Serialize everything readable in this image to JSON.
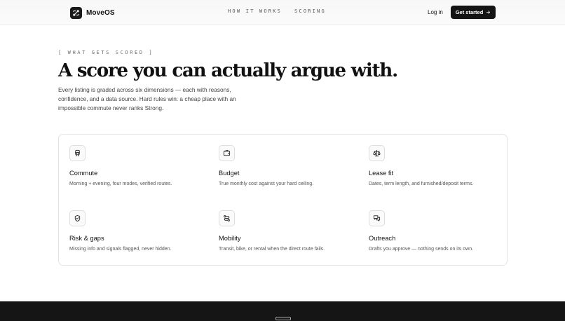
{
  "nav": {
    "brand": "MoveOS",
    "links": [
      "HOW IT WORKS",
      "SCORING"
    ],
    "login": "Log in",
    "cta": "Get started",
    "cta_icon": "arrow-right-icon"
  },
  "hero": {
    "eyebrow": "[ WHAT GETS SCORED ]",
    "headline": "A score you can actually argue with.",
    "lede": "Every listing is graded across six dimensions — each with reasons, confidence, and a data source. Hard rules win: a cheap place with an impossible commute never ranks Strong."
  },
  "features": [
    {
      "title": "Commute",
      "desc": "Morning + evening, four modes, verified routes.",
      "icon": "train-icon"
    },
    {
      "title": "Budget",
      "desc": "True monthly cost against your hard ceiling.",
      "icon": "wallet-icon"
    },
    {
      "title": "Lease fit",
      "desc": "Dates, term length, and furnished/deposit terms.",
      "icon": "scale-icon"
    },
    {
      "title": "Risk & gaps",
      "desc": "Missing info and signals flagged, never hidden.",
      "icon": "shield-icon"
    },
    {
      "title": "Mobility",
      "desc": "Transit, bike, or rental when the direct route fails.",
      "icon": "route-icon"
    },
    {
      "title": "Outreach",
      "desc": "Drafts you approve — nothing sends on its own.",
      "icon": "chat-icon"
    }
  ],
  "colors": {
    "accent": "#141414",
    "text": "#111111",
    "muted": "#555555",
    "border": "#e4e4e4",
    "footer": "#151515"
  }
}
